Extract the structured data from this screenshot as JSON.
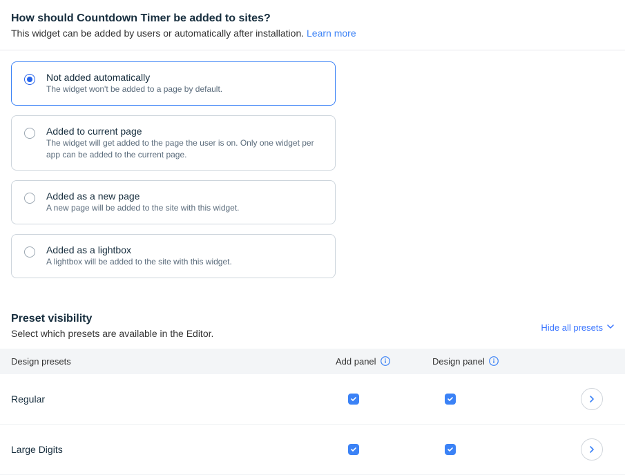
{
  "header": {
    "title": "How should Countdown Timer be added to sites?",
    "subtitle": "This widget can be added by users or automatically after installation. ",
    "link": "Learn more"
  },
  "options": [
    {
      "label": "Not added automatically",
      "desc": "The widget won't be added to a page by default.",
      "selected": true
    },
    {
      "label": "Added to current page",
      "desc": "The widget will get added to the page the user is on. Only one widget per app can be added to the current page.",
      "selected": false
    },
    {
      "label": "Added as a new page",
      "desc": "A new page will be added to the site with this widget.",
      "selected": false
    },
    {
      "label": "Added as a lightbox",
      "desc": "A lightbox will be added to the site with this widget.",
      "selected": false
    }
  ],
  "presets": {
    "title": "Preset visibility",
    "subtitle": "Select which presets are available in the Editor.",
    "hide_link": "Hide all presets",
    "columns": {
      "col1": "Design presets",
      "col2": "Add panel",
      "col3": "Design panel"
    },
    "rows": [
      {
        "name": "Regular",
        "add": true,
        "design": true
      },
      {
        "name": "Large Digits",
        "add": true,
        "design": true
      }
    ]
  }
}
